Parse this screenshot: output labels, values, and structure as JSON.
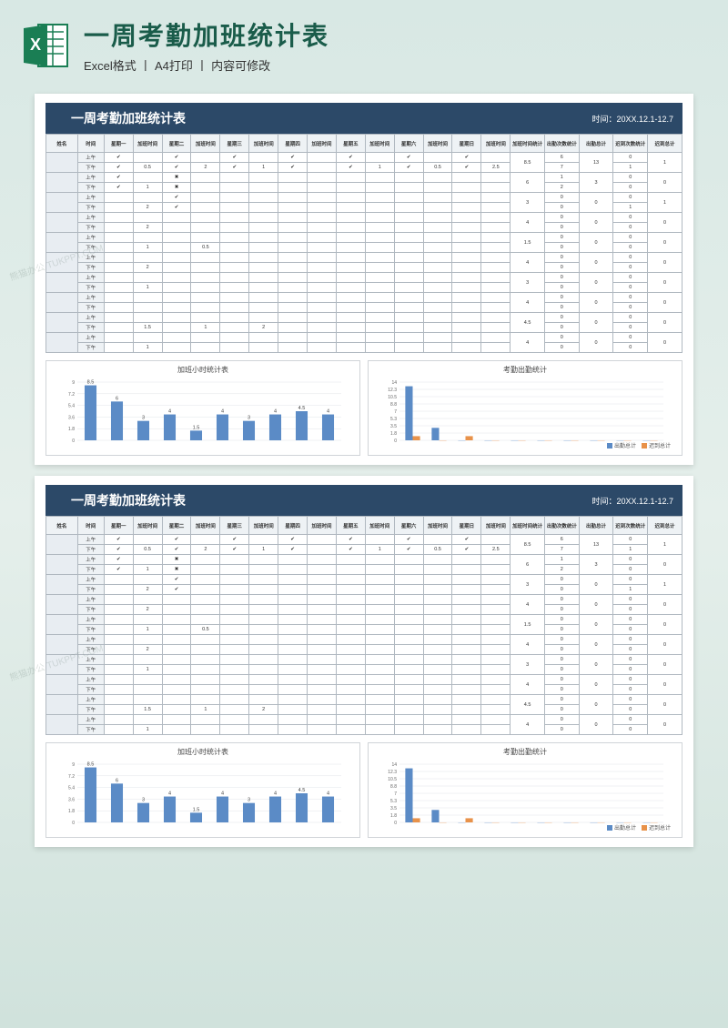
{
  "header": {
    "main_title": "一周考勤加班统计表",
    "sub_title": "Excel格式 丨 A4打印 丨 内容可修改",
    "excel_label": "X"
  },
  "sheet": {
    "title": "一周考勤加班统计表",
    "time_label": "时间：",
    "time_value": "20XX.12.1-12.7",
    "columns": {
      "name": "姓名",
      "slot": "时间",
      "mon": "星期一",
      "mon_ot": "加班时间",
      "tue": "星期二",
      "tue_ot": "加班时间",
      "wed": "星期三",
      "wed_ot": "加班时间",
      "thu": "星期四",
      "thu_ot": "加班时间",
      "fri": "星期五",
      "fri_ot": "加班时间",
      "sat": "星期六",
      "sat_ot": "加班时间",
      "sun": "星期日",
      "sun_ot": "加班时间",
      "ot_total": "加班时间统计",
      "attend_total": "出勤次数统计",
      "attend_sum": "出勤总计",
      "late_total": "迟到次数统计",
      "late_sum": "迟到总计"
    },
    "slot_am": "上午",
    "slot_pm": "下午",
    "check": "✔",
    "cross": "✖",
    "rows": [
      {
        "am": {
          "d": [
            "✔",
            "",
            "✔",
            "",
            "✔",
            "",
            "✔",
            "",
            "✔",
            "",
            "✔",
            "",
            "✔",
            ""
          ],
          "at": "6",
          "lt": "0"
        },
        "pm": {
          "d": [
            "✔",
            "0.5",
            "✔",
            "2",
            "✔",
            "1",
            "✔",
            "",
            "✔",
            "1",
            "✔",
            "0.5",
            "✔",
            "2.5"
          ],
          "at": "7",
          "lt": "1"
        },
        "ot": "8.5",
        "asum": "13",
        "lsum": "1"
      },
      {
        "am": {
          "d": [
            "✔",
            "",
            "✖",
            "",
            "",
            "",
            "",
            "",
            "",
            "",
            "",
            "",
            "",
            ""
          ],
          "at": "1",
          "lt": "0"
        },
        "pm": {
          "d": [
            "✔",
            "1",
            "✖",
            "",
            "",
            "",
            "",
            "",
            "",
            "",
            "",
            "",
            "",
            ""
          ],
          "at": "2",
          "lt": "0"
        },
        "ot": "6",
        "asum": "3",
        "lsum": "0"
      },
      {
        "am": {
          "d": [
            "",
            "",
            "✔",
            "",
            "",
            "",
            "",
            "",
            "",
            "",
            "",
            "",
            "",
            ""
          ],
          "at": "0",
          "lt": "0"
        },
        "pm": {
          "d": [
            "",
            "2",
            "✔",
            "",
            "",
            "",
            "",
            "",
            "",
            "",
            "",
            "",
            "",
            ""
          ],
          "at": "0",
          "lt": "1"
        },
        "ot": "3",
        "asum": "0",
        "lsum": "1"
      },
      {
        "am": {
          "d": [
            "",
            "",
            "",
            "",
            "",
            "",
            "",
            "",
            "",
            "",
            "",
            "",
            "",
            ""
          ],
          "at": "0",
          "lt": "0"
        },
        "pm": {
          "d": [
            "",
            "2",
            "",
            "",
            "",
            "",
            "",
            "",
            "",
            "",
            "",
            "",
            "",
            ""
          ],
          "at": "0",
          "lt": "0"
        },
        "ot": "4",
        "asum": "0",
        "lsum": "0"
      },
      {
        "am": {
          "d": [
            "",
            "",
            "",
            "",
            "",
            "",
            "",
            "",
            "",
            "",
            "",
            "",
            "",
            ""
          ],
          "at": "0",
          "lt": "0"
        },
        "pm": {
          "d": [
            "",
            "1",
            "",
            "0.5",
            "",
            "",
            "",
            "",
            "",
            "",
            "",
            "",
            "",
            ""
          ],
          "at": "0",
          "lt": "0"
        },
        "ot": "1.5",
        "asum": "0",
        "lsum": "0"
      },
      {
        "am": {
          "d": [
            "",
            "",
            "",
            "",
            "",
            "",
            "",
            "",
            "",
            "",
            "",
            "",
            "",
            ""
          ],
          "at": "0",
          "lt": "0"
        },
        "pm": {
          "d": [
            "",
            "2",
            "",
            "",
            "",
            "",
            "",
            "",
            "",
            "",
            "",
            "",
            "",
            ""
          ],
          "at": "0",
          "lt": "0"
        },
        "ot": "4",
        "asum": "0",
        "lsum": "0"
      },
      {
        "am": {
          "d": [
            "",
            "",
            "",
            "",
            "",
            "",
            "",
            "",
            "",
            "",
            "",
            "",
            "",
            ""
          ],
          "at": "0",
          "lt": "0"
        },
        "pm": {
          "d": [
            "",
            "1",
            "",
            "",
            "",
            "",
            "",
            "",
            "",
            "",
            "",
            "",
            "",
            ""
          ],
          "at": "0",
          "lt": "0"
        },
        "ot": "3",
        "asum": "0",
        "lsum": "0"
      },
      {
        "am": {
          "d": [
            "",
            "",
            "",
            "",
            "",
            "",
            "",
            "",
            "",
            "",
            "",
            "",
            "",
            ""
          ],
          "at": "0",
          "lt": "0"
        },
        "pm": {
          "d": [
            "",
            "",
            "",
            "",
            "",
            "",
            "",
            "",
            "",
            "",
            "",
            "",
            "",
            ""
          ],
          "at": "0",
          "lt": "0"
        },
        "ot": "4",
        "asum": "0",
        "lsum": "0"
      },
      {
        "am": {
          "d": [
            "",
            "",
            "",
            "",
            "",
            "",
            "",
            "",
            "",
            "",
            "",
            "",
            "",
            ""
          ],
          "at": "0",
          "lt": "0"
        },
        "pm": {
          "d": [
            "",
            "1.5",
            "",
            "1",
            "",
            "2",
            "",
            "",
            "",
            "",
            "",
            "",
            "",
            ""
          ],
          "at": "0",
          "lt": "0"
        },
        "ot": "4.5",
        "asum": "0",
        "lsum": "0"
      },
      {
        "am": {
          "d": [
            "",
            "",
            "",
            "",
            "",
            "",
            "",
            "",
            "",
            "",
            "",
            "",
            "",
            ""
          ],
          "at": "0",
          "lt": "0"
        },
        "pm": {
          "d": [
            "",
            "1",
            "",
            "",
            "",
            "",
            "",
            "",
            "",
            "",
            "",
            "",
            "",
            ""
          ],
          "at": "0",
          "lt": "0"
        },
        "ot": "4",
        "asum": "0",
        "lsum": "0"
      }
    ]
  },
  "chart_data": [
    {
      "type": "bar",
      "title": "加班小时统计表",
      "categories": [
        "",
        "",
        "",
        "",
        "",
        "",
        "",
        "",
        "",
        ""
      ],
      "values": [
        8.5,
        6,
        3,
        4,
        1.5,
        4,
        3,
        4,
        4.5,
        4
      ],
      "ylim": [
        0,
        9
      ],
      "color": "#5b8bc6",
      "show_labels": true
    },
    {
      "type": "bar",
      "title": "考勤出勤统计",
      "categories": [
        "",
        "",
        "",
        "",
        "",
        "",
        "",
        "",
        "",
        ""
      ],
      "series": [
        {
          "name": "出勤总计",
          "values": [
            13,
            3,
            0,
            0,
            0,
            0,
            0,
            0,
            0,
            0
          ],
          "color": "#5b8bc6"
        },
        {
          "name": "迟到总计",
          "values": [
            1,
            0,
            1,
            0,
            0,
            0,
            0,
            0,
            0,
            0
          ],
          "color": "#e8924a"
        }
      ],
      "ylim": [
        0,
        14
      ],
      "legend": [
        "出勤总计",
        "迟到总计"
      ]
    }
  ],
  "watermark": "熊猫办公 TUKPPT.COM"
}
